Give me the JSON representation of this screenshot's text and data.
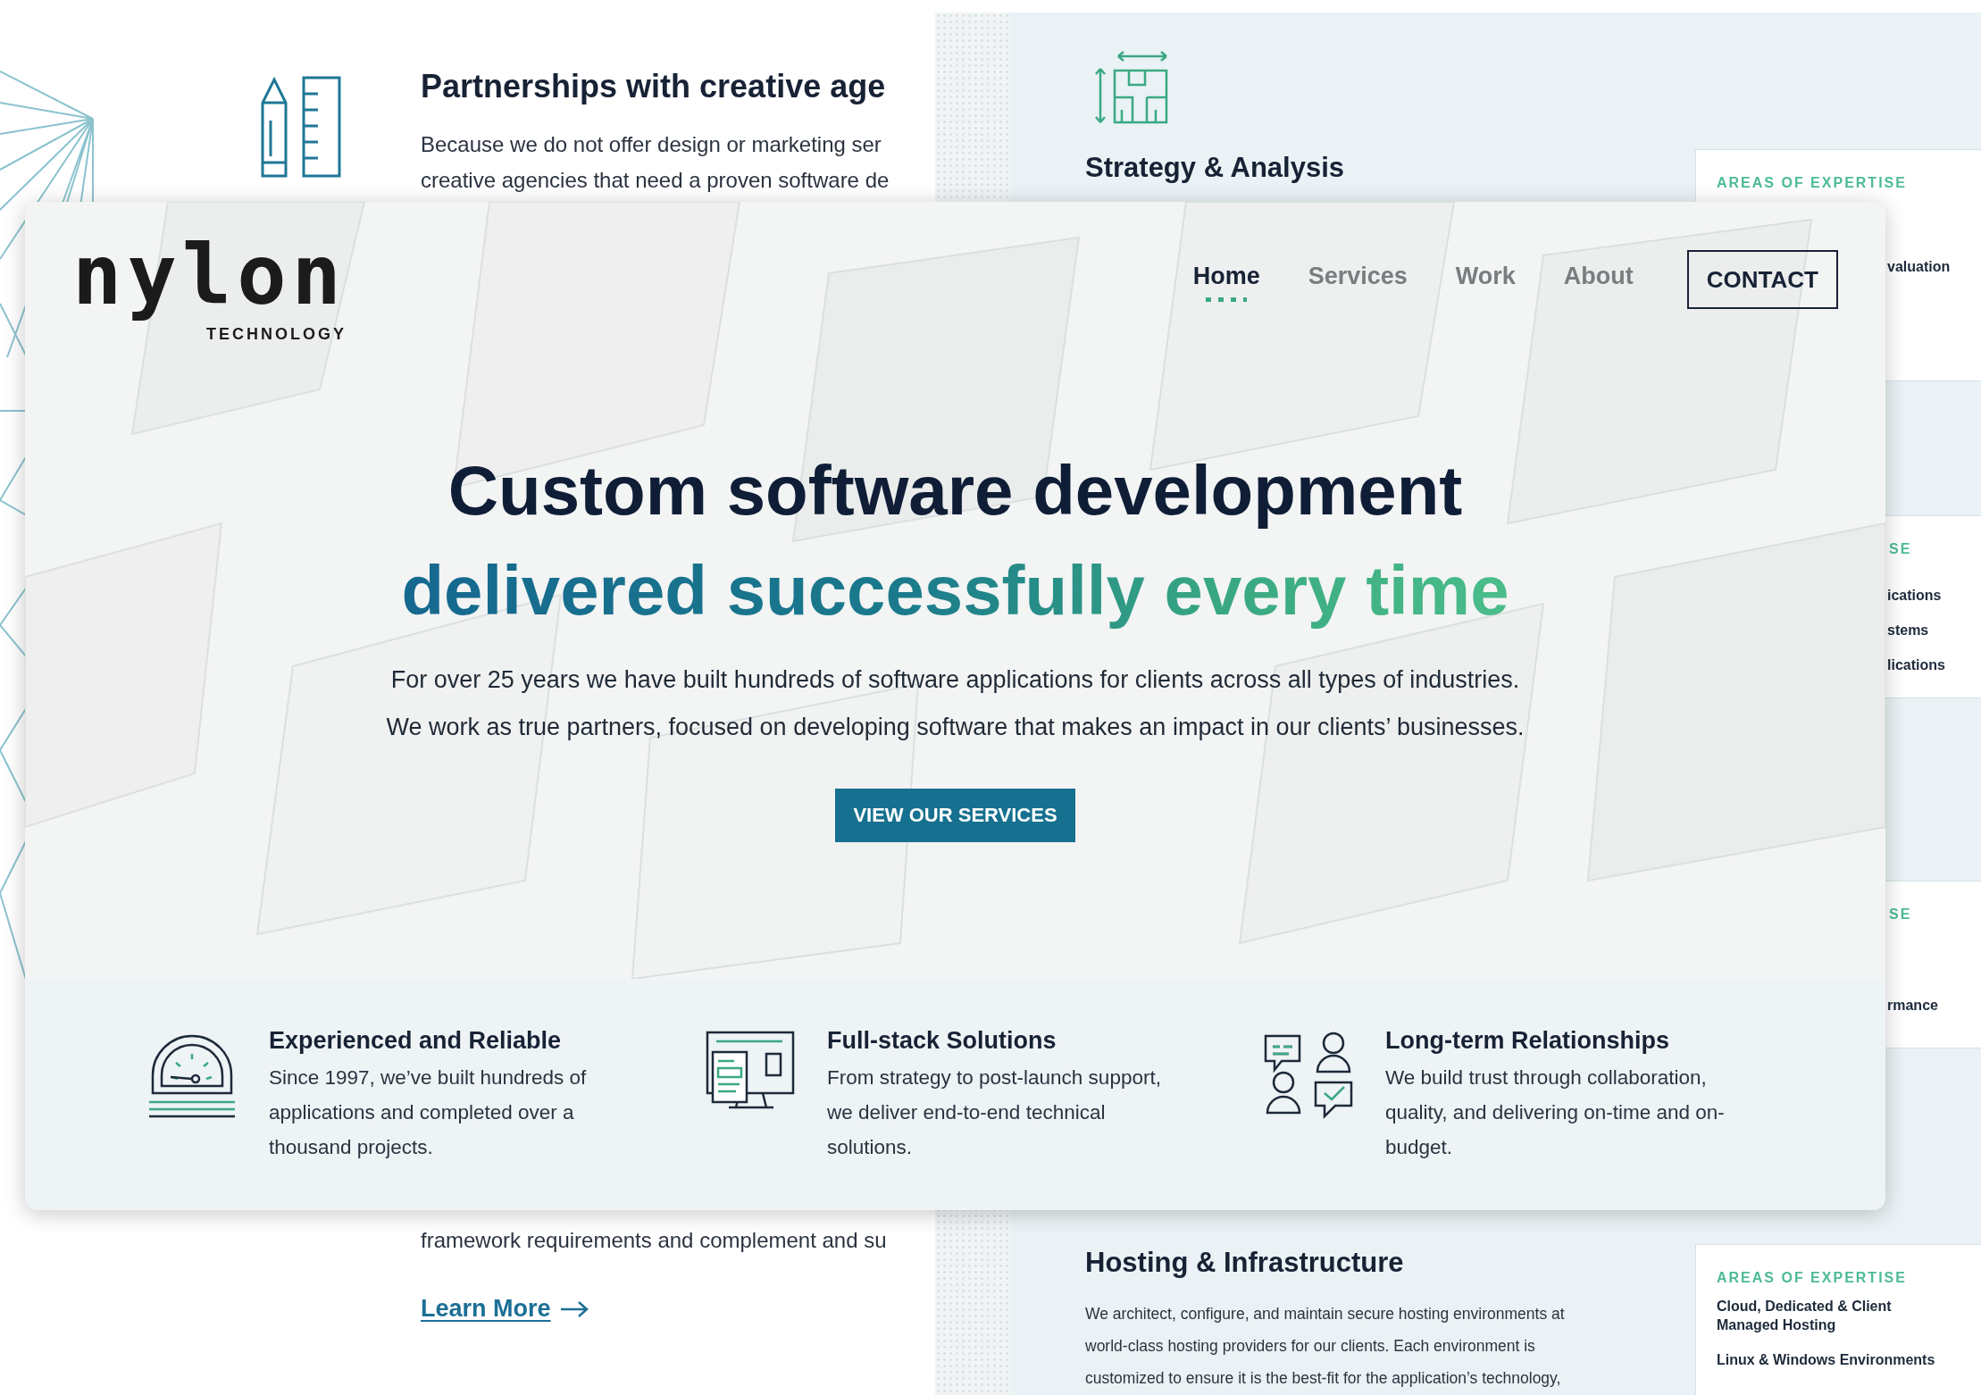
{
  "left_page": {
    "heading": "Partnerships with creative age",
    "body_lines": [
      "Because we do not offer design or marketing ser",
      "creative agencies that need a proven software de"
    ],
    "lower_line": "framework requirements and complement and su",
    "link": "Learn More"
  },
  "right_page": {
    "top_heading": "Strategy & Analysis",
    "cards": [
      {
        "label": "AREAS OF EXPERTISE",
        "items": [
          "valuation"
        ]
      },
      {
        "label": "SE",
        "items": [
          "ications",
          "stems",
          "lications"
        ]
      },
      {
        "label": "SE",
        "items": [
          "rmance"
        ]
      },
      {
        "label": "AREAS OF EXPERTISE",
        "items": [
          "Cloud, Dedicated & Client Managed Hosting",
          "Linux & Windows Environments"
        ]
      }
    ],
    "bottom_heading": "Hosting & Infrastructure",
    "bottom_lines": [
      "We architect, configure, and maintain secure hosting environments at",
      "world-class hosting providers for our clients. Each environment is",
      "customized to ensure it is the best-fit for the application’s technology,"
    ]
  },
  "main_window": {
    "logo": {
      "wordmark": "nylon",
      "tagline": "TECHNOLOGY"
    },
    "nav": [
      {
        "label": "Home",
        "selected": true
      },
      {
        "label": "Services",
        "selected": false
      },
      {
        "label": "Work",
        "selected": false
      },
      {
        "label": "About",
        "selected": false
      }
    ],
    "contact_button": "CONTACT",
    "hero": {
      "headline": "Custom software development",
      "subheadline": "delivered successfully every time",
      "intro_lines": [
        "For over 25 years we have built hundreds of software applications for clients across all types of industries.",
        "We work as true partners, focused on developing software that makes an impact in our clients’ businesses."
      ],
      "button": "VIEW OUR SERVICES"
    },
    "features": [
      {
        "kind": "gauge",
        "title": "Experienced and Reliable",
        "lines": [
          "Since 1997, we’ve built hundreds of",
          "applications and completed over a",
          "thousand projects."
        ]
      },
      {
        "kind": "screens",
        "title": "Full-stack Solutions",
        "lines": [
          "From strategy to post-launch support,",
          "we deliver end-to-end technical",
          "solutions."
        ]
      },
      {
        "kind": "people",
        "title": "Long-term Relationships",
        "lines": [
          "We build trust through collaboration,",
          "quality, and delivering on-time and on-",
          "budget."
        ]
      }
    ]
  }
}
